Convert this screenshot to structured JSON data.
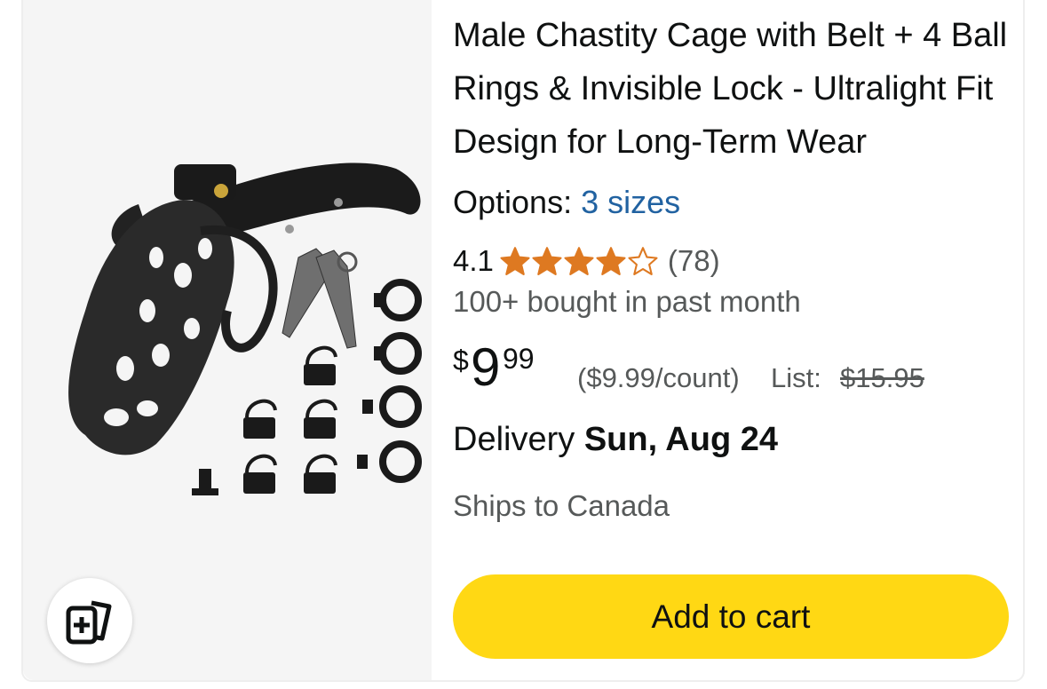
{
  "product": {
    "title": "Male Chastity Cage with Belt + 4 Ball Rings & Invisible Lock - Ultralight Fit Design for Long-Term Wear",
    "image_alt": "Black cage device with belt strap, keys, four rings and plastic locks",
    "options_label": "Options:",
    "options_link": "3 sizes",
    "rating_value": "4.1",
    "rating_stars": 4.1,
    "review_count": "(78)",
    "bought": "100+ bought in past month",
    "price_symbol": "$",
    "price_whole": "9",
    "price_fraction": "99",
    "unit_price": "($9.99/count)",
    "list_label": "List:",
    "list_price": "$15.95",
    "delivery_label": "Delivery",
    "delivery_date": "Sun, Aug 24",
    "ships_to": "Ships to Canada",
    "add_to_cart": "Add to cart"
  },
  "icons": {
    "compare": "compare-cards-icon",
    "star": "star-icon"
  },
  "colors": {
    "star": "#de7921",
    "link": "#2162a1",
    "button": "#ffd814",
    "image_bg": "#f5f5f5"
  }
}
